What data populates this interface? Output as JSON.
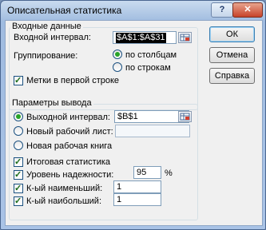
{
  "window": {
    "title": "Описательная статистика",
    "help_glyph": "?",
    "close_glyph": "✕"
  },
  "input_group": {
    "title": "Входные данные",
    "input_range_label": "Входной интервал:",
    "input_range_value": "$A$1:$A$31",
    "grouping_label": "Группирование:",
    "by_columns": "по столбцам",
    "by_rows": "по строкам",
    "labels_first_row": "Метки в первой строке"
  },
  "output_group": {
    "title": "Параметры вывода",
    "output_range_label": "Выходной интервал:",
    "output_range_value": "$B$1",
    "new_sheet_label": "Новый рабочий лист:",
    "new_workbook_label": "Новая рабочая книга",
    "summary_stats_label": "Итоговая статистика",
    "confidence_label": "Уровень надежности:",
    "confidence_value": "95",
    "percent_sign": "%",
    "kth_smallest_label": "К-ый наименьший:",
    "kth_smallest_value": "1",
    "kth_largest_label": "К-ый наибольший:",
    "kth_largest_value": "1"
  },
  "buttons": {
    "ok": "ОК",
    "cancel": "Отмена",
    "help": "Справка"
  },
  "checkmark": "✓",
  "colors": {
    "radio_dot": "#28a428",
    "selection": "#000000"
  }
}
